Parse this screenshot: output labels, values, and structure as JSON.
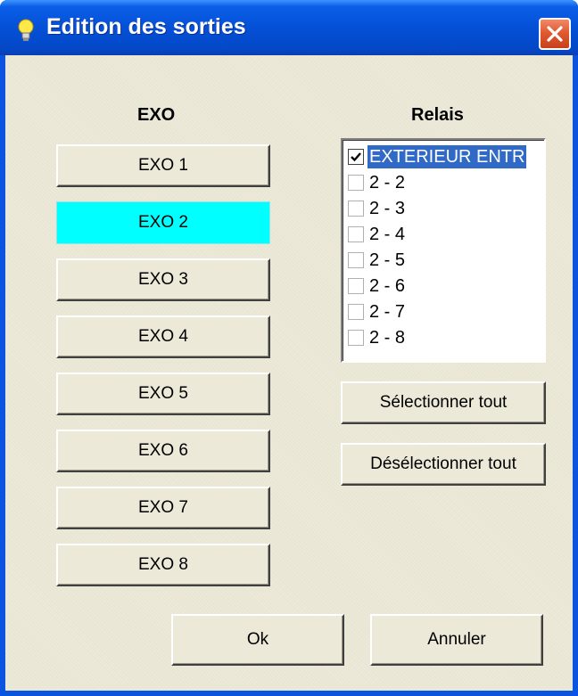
{
  "window": {
    "title": "Edition des sorties"
  },
  "exo_column": {
    "title": "EXO",
    "buttons": [
      {
        "label": "EXO 1",
        "active": false
      },
      {
        "label": "EXO 2",
        "active": true
      },
      {
        "label": "EXO 3",
        "active": false
      },
      {
        "label": "EXO 4",
        "active": false
      },
      {
        "label": "EXO 5",
        "active": false
      },
      {
        "label": "EXO 6",
        "active": false
      },
      {
        "label": "EXO 7",
        "active": false
      },
      {
        "label": "EXO 8",
        "active": false
      }
    ]
  },
  "relais_column": {
    "title": "Relais",
    "items": [
      {
        "label": "EXTERIEUR ENTR",
        "checked": true,
        "selected": true
      },
      {
        "label": "2 - 2",
        "checked": false,
        "selected": false
      },
      {
        "label": "2 - 3",
        "checked": false,
        "selected": false
      },
      {
        "label": "2 - 4",
        "checked": false,
        "selected": false
      },
      {
        "label": "2 - 5",
        "checked": false,
        "selected": false
      },
      {
        "label": "2 - 6",
        "checked": false,
        "selected": false
      },
      {
        "label": "2 - 7",
        "checked": false,
        "selected": false
      },
      {
        "label": "2 - 8",
        "checked": false,
        "selected": false
      }
    ],
    "select_all_label": "Sélectionner tout",
    "deselect_all_label": "Désélectionner tout"
  },
  "footer": {
    "ok_label": "Ok",
    "cancel_label": "Annuler"
  },
  "colors": {
    "active_button": "#00ffff",
    "selection": "#3169c6",
    "titlebar": "#0450d6",
    "face": "#ece9d8"
  },
  "icons": {
    "title": "lightbulb-icon",
    "close": "close-icon",
    "check": "checkmark-icon"
  }
}
